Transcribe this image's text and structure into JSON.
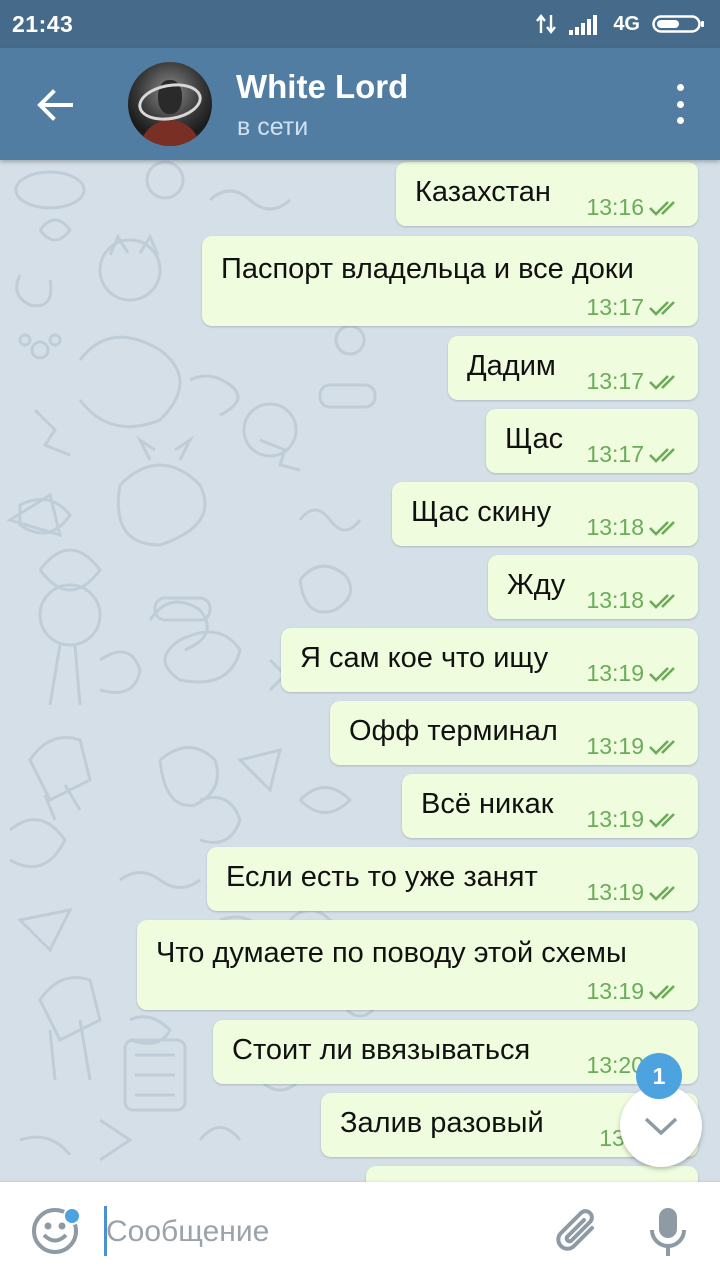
{
  "status_bar": {
    "time": "21:43",
    "network": "4G",
    "icons": [
      "data-transfer-icon",
      "signal-icon",
      "battery-icon"
    ]
  },
  "header": {
    "contact_name": "White Lord",
    "contact_status": "в сети",
    "icons": [
      "back-arrow-icon",
      "avatar",
      "more-vertical-icon"
    ]
  },
  "messages": [
    {
      "text": "Казахстан",
      "time": "13:16",
      "status": "read"
    },
    {
      "text": "Паспорт владельца и все доки",
      "time": "13:17",
      "status": "read"
    },
    {
      "text": "Дадим",
      "time": "13:17",
      "status": "read"
    },
    {
      "text": "Щас",
      "time": "13:17",
      "status": "read"
    },
    {
      "text": "Щас скину",
      "time": "13:18",
      "status": "read"
    },
    {
      "text": "Жду",
      "time": "13:18",
      "status": "read"
    },
    {
      "text": "Я сам кое что ищу",
      "time": "13:19",
      "status": "read"
    },
    {
      "text": "Офф терминал",
      "time": "13:19",
      "status": "read"
    },
    {
      "text": "Всё никак",
      "time": "13:19",
      "status": "read"
    },
    {
      "text": "Если есть то уже занят",
      "time": "13:19",
      "status": "read"
    },
    {
      "text": "Что думаете по поводу этой схемы",
      "time": "13:19",
      "status": "read"
    },
    {
      "text": "Стоит ли ввязываться",
      "time": "13:20",
      "status": "read"
    },
    {
      "text": "Залив разовый",
      "time": "13:2",
      "status": "read"
    },
    {
      "text": "",
      "time": "",
      "status": "read"
    }
  ],
  "scroll_button": {
    "unread_count": "1"
  },
  "composer": {
    "placeholder": "Сообщение",
    "value": ""
  },
  "colors": {
    "status_bar": "#466b8a",
    "header": "#527da3",
    "bubble_out": "#effdde",
    "time_and_check": "#6bab59",
    "badge": "#4da3e0"
  }
}
